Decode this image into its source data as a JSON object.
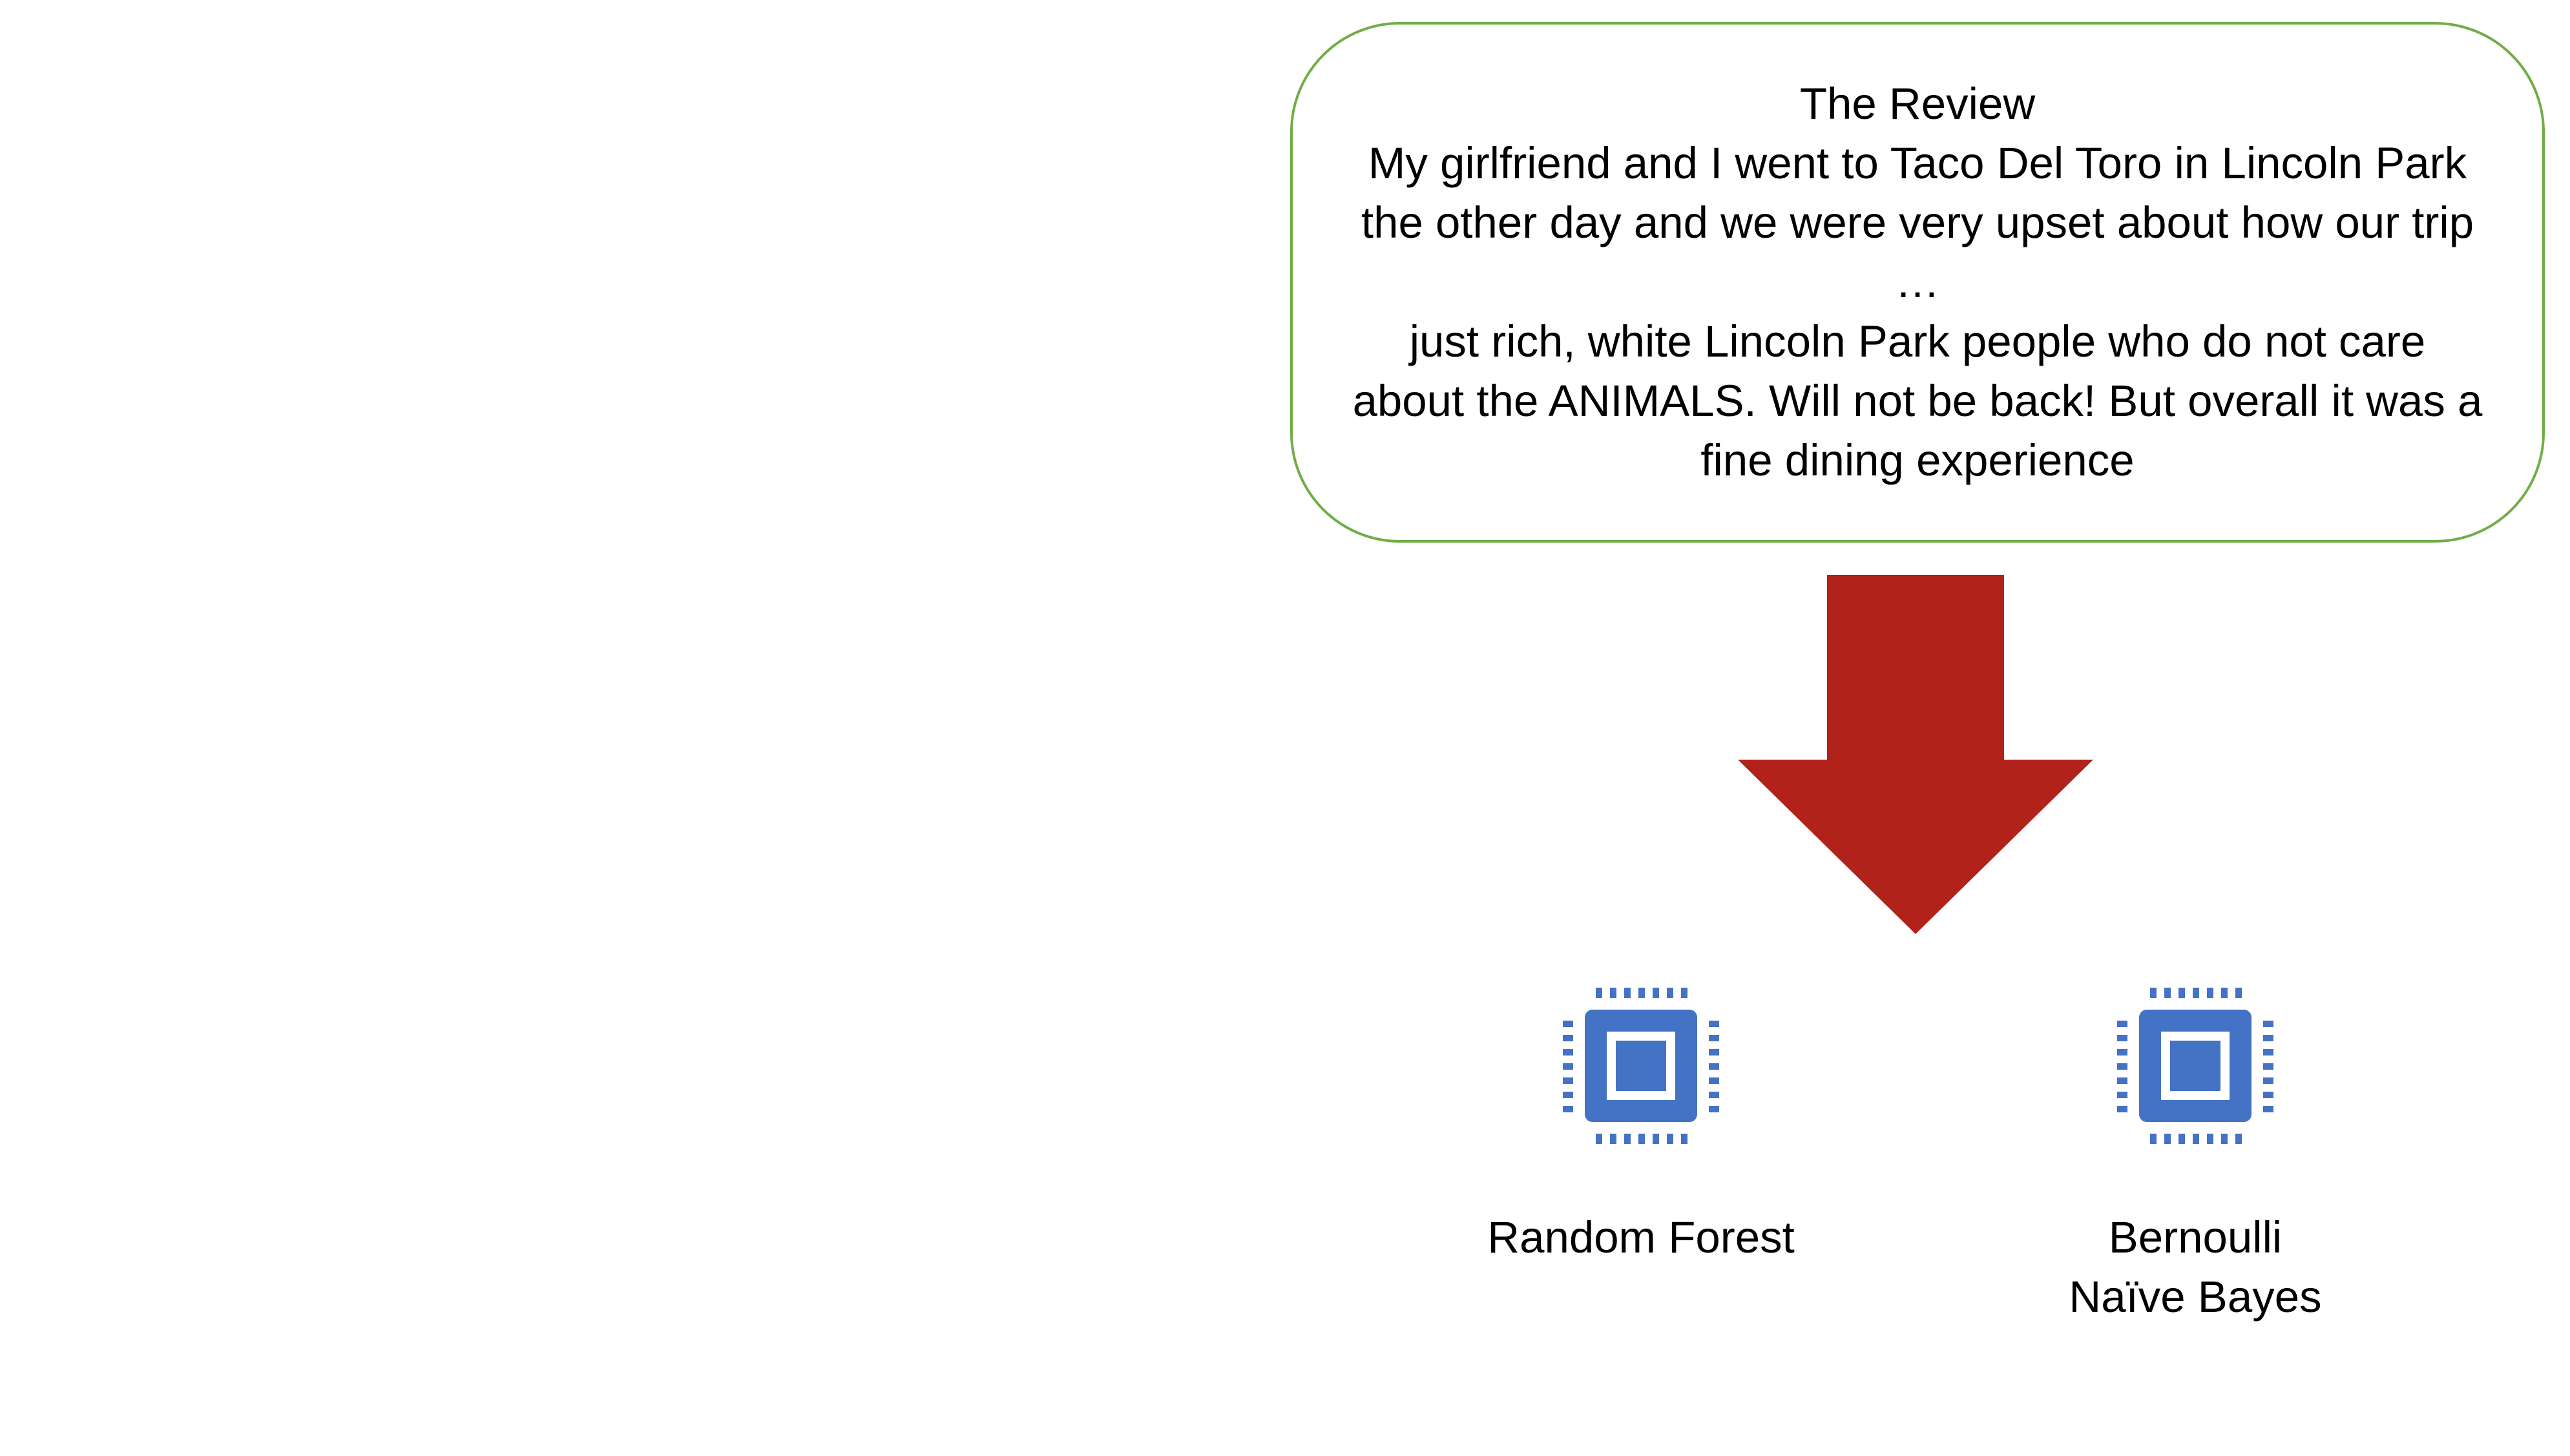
{
  "review": {
    "title": "The Review",
    "lines": [
      "My girlfriend and I went to Taco Del Toro in Lincoln Park",
      "the other day and we were very upset about how our trip",
      "…",
      "just rich, white Lincoln Park people who do not care",
      "about the ANIMALS. Will not be back! But overall it was a",
      "fine dining experience"
    ]
  },
  "models": [
    {
      "icon": "processor-chip-icon",
      "label_lines": [
        "Random Forest"
      ]
    },
    {
      "icon": "processor-chip-icon",
      "label_lines": [
        "Bernoulli",
        "Naïve Bayes"
      ]
    }
  ],
  "colors": {
    "box_border": "#70ad47",
    "arrow": "#b0221a",
    "chip": "#4472c4"
  }
}
